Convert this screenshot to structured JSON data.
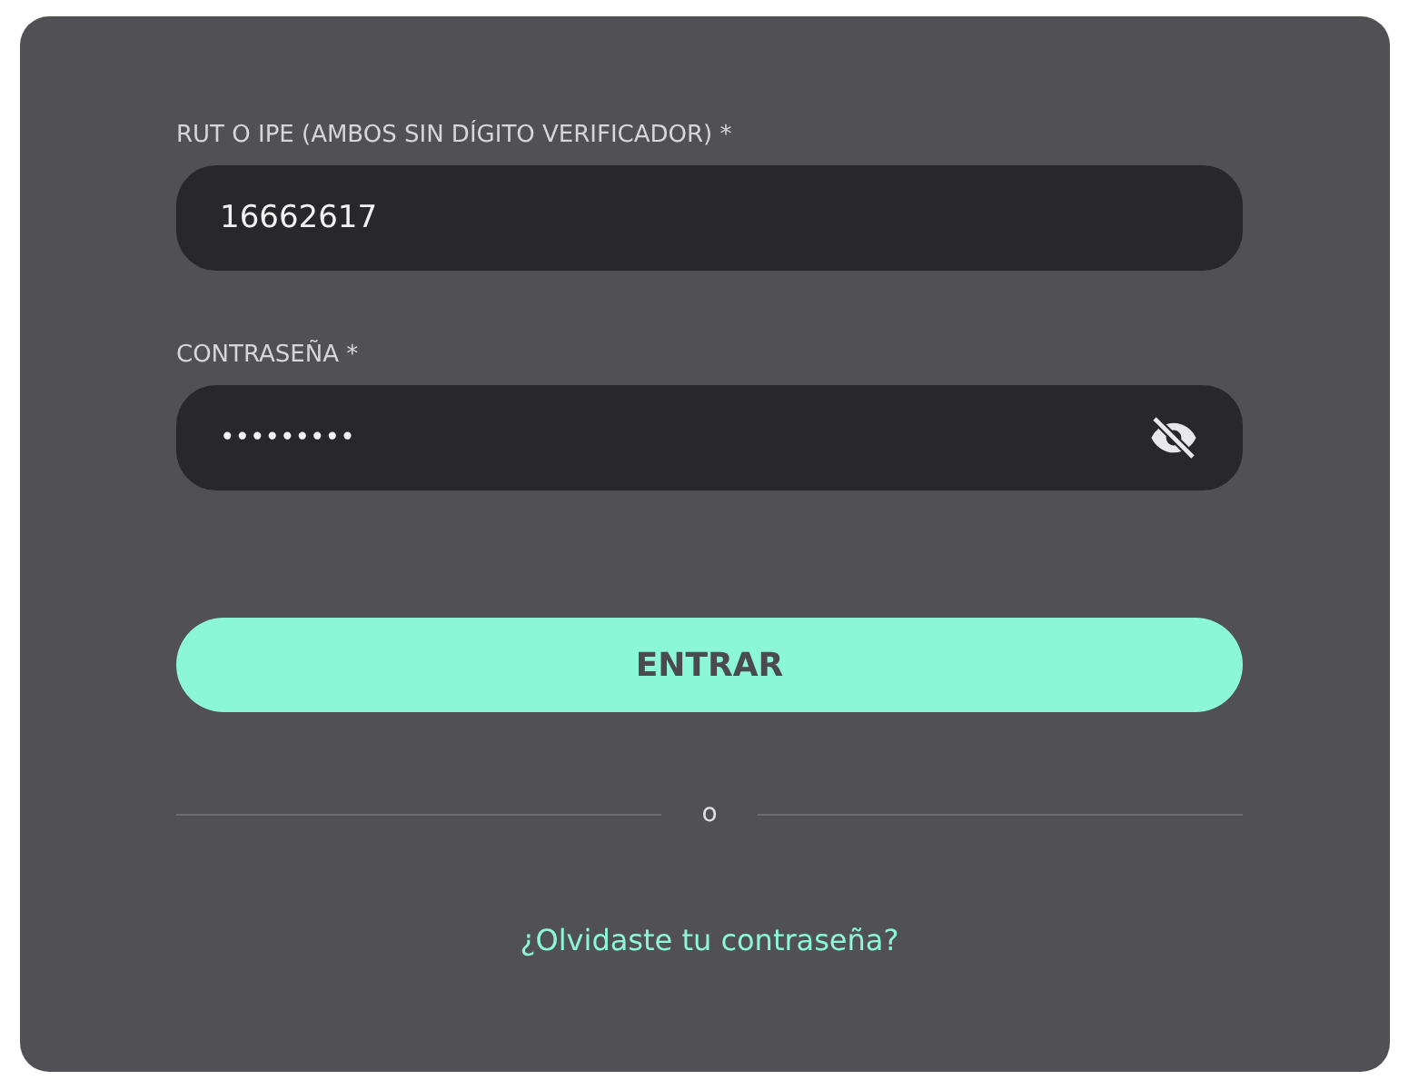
{
  "fields": [
    {
      "kind": "text",
      "label": "RUT O IPE (AMBOS SIN DÍGITO VERIFICADOR) *",
      "value": "16662617"
    },
    {
      "kind": "password",
      "label": "CONTRASEÑA *",
      "value": "•••••••••",
      "password_visible": false
    }
  ],
  "submit_button": "ENTRAR",
  "divider_text": "o",
  "forgot_link": "¿Olvidaste tu contraseña?"
}
